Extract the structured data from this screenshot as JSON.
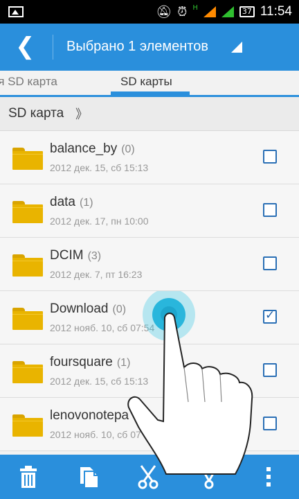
{
  "status_bar": {
    "network_label": "H",
    "battery": "37",
    "time": "11:54"
  },
  "action_bar": {
    "title": "Выбрано 1 элементов"
  },
  "tabs": [
    {
      "label": "яя SD карта"
    },
    {
      "label": "SD карты"
    }
  ],
  "breadcrumb": {
    "label": "SD карта",
    "arrow": "》"
  },
  "files": [
    {
      "name": "balance_by",
      "count": "(0)",
      "date": "2012 дек. 15, сб 15:13",
      "checked": false
    },
    {
      "name": "data",
      "count": "(1)",
      "date": "2012 дек. 17, пн 10:00",
      "checked": false
    },
    {
      "name": "DCIM",
      "count": "(3)",
      "date": "2012 дек. 7, пт 16:23",
      "checked": false
    },
    {
      "name": "Download",
      "count": "(0)",
      "date": "2012 нояб. 10, сб 07:54",
      "checked": true
    },
    {
      "name": "foursquare",
      "count": "(1)",
      "date": "2012 дек. 15, сб 15:13",
      "checked": false
    },
    {
      "name": "lenovonotepa",
      "count": "",
      "date": "2012 нояб. 10, сб 07",
      "checked": false
    }
  ],
  "toolbar": {
    "items": [
      "delete-icon",
      "copy-icon",
      "cut-icon",
      "share-icon",
      "overflow-menu-icon"
    ]
  },
  "colors": {
    "accent": "#2a8fdc",
    "folder": "#e9b400"
  }
}
